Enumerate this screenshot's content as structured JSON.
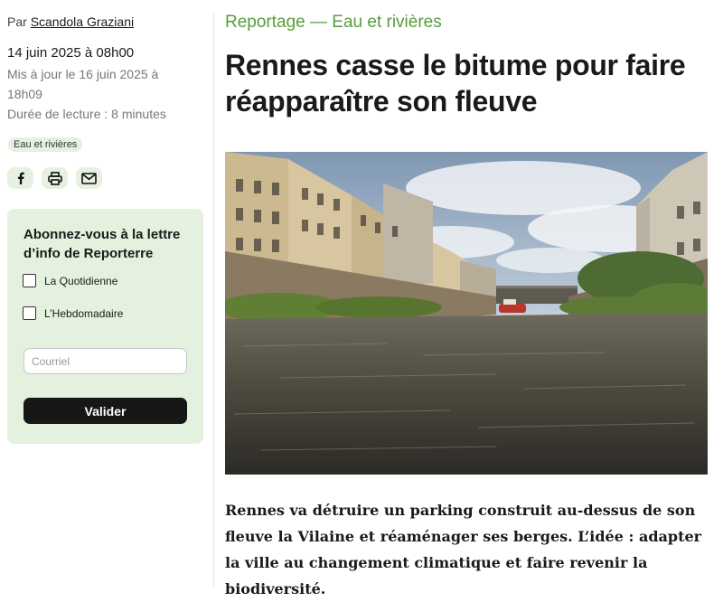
{
  "byline": {
    "prefix": "Par",
    "author": "Scandola Graziani"
  },
  "meta": {
    "published": "14 juin 2025 à 08h00",
    "updated": "Mis à jour le 16 juin 2025 à 18h09",
    "reading_time": "Durée de lecture : 8 minutes"
  },
  "tag": "Eau et rivières",
  "share": [
    {
      "icon": "facebook-icon"
    },
    {
      "icon": "print-icon"
    },
    {
      "icon": "mail-icon"
    }
  ],
  "newsletter": {
    "title": "Abonnez-vous à la lettre d’info de Reporterre",
    "options": [
      "La Quotidienne",
      "L’Hebdomadaire"
    ],
    "email_placeholder": "Courriel",
    "submit_label": "Valider",
    "background_color": "#e4f1de"
  },
  "article": {
    "kicker": "Reportage — Eau et rivières",
    "kicker_color": "#5a9c3d",
    "title": "Rennes casse le bitume pour faire réapparaître son fleuve",
    "lead": "Rennes va détruire un parking construit au-dessus de son fleuve la Vilaine et réaménager ses berges. L’idée : adapter la ville au changement climatique et faire revenir la biodiversité."
  }
}
